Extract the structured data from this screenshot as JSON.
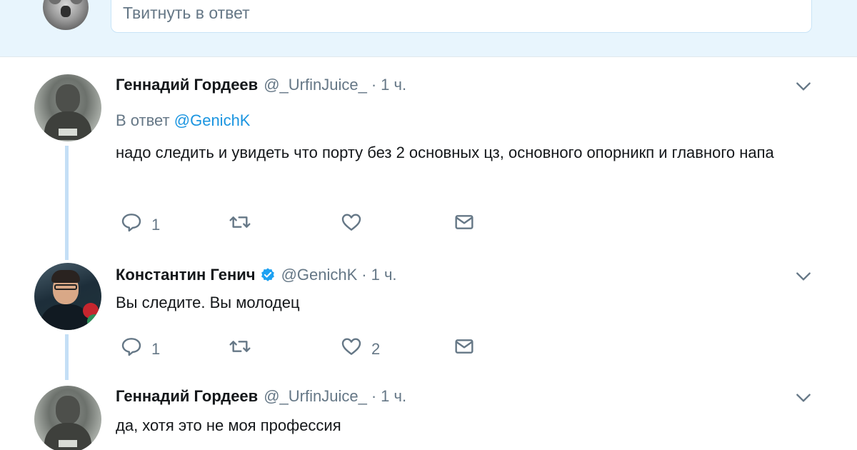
{
  "composer": {
    "placeholder": "Твитнуть в ответ"
  },
  "colors": {
    "accent": "#1b95e0",
    "thread_line": "#c4dff6",
    "secondary_text": "#657786"
  },
  "tweets": [
    {
      "author_name": "Геннадий Гордеев",
      "handle": "@_UrfinJuice_",
      "time": "1 ч.",
      "verified": false,
      "reply_prefix": "В ответ",
      "reply_mention": "@GenichK",
      "text": "надо следить и увидеть что порту без 2 основных цз, основного опорникп и главного напа",
      "actions": {
        "reply_count": "1",
        "retweet_count": "",
        "like_count": ""
      },
      "icons": [
        "reply-icon",
        "retweet-icon",
        "like-heart-icon",
        "direct-message-icon",
        "chevron-down-icon"
      ]
    },
    {
      "author_name": "Константин Генич",
      "handle": "@GenichK",
      "time": "1 ч.",
      "verified": true,
      "text": "Вы следите. Вы молодец",
      "actions": {
        "reply_count": "1",
        "retweet_count": "",
        "like_count": "2"
      },
      "icons": [
        "reply-icon",
        "retweet-icon",
        "like-heart-icon",
        "direct-message-icon",
        "chevron-down-icon",
        "verified-badge-icon"
      ]
    },
    {
      "author_name": "Геннадий Гордеев",
      "handle": "@_UrfinJuice_",
      "time": "1 ч.",
      "verified": false,
      "text": "да, хотя это не моя профессия",
      "icons": [
        "chevron-down-icon"
      ]
    }
  ],
  "separator": "·"
}
